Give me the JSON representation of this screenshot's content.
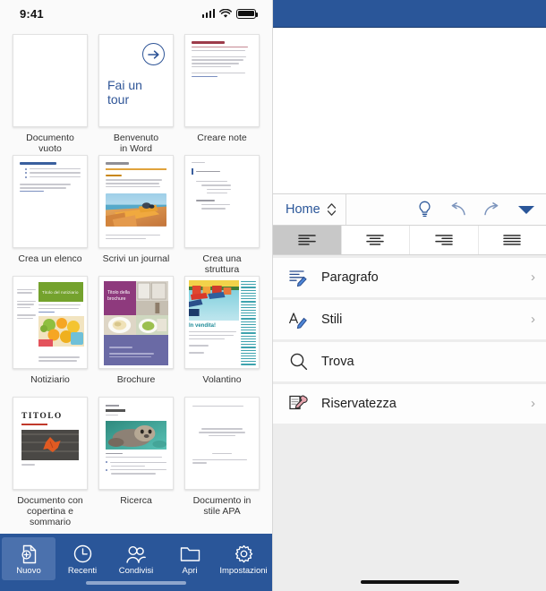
{
  "status_bar": {
    "time": "9:41",
    "signal_icon": "cellular-signal-icon",
    "wifi_icon": "wifi-icon",
    "battery_icon": "battery-full-icon"
  },
  "colors": {
    "brand_blue": "#2a5699",
    "tab_selected": "#4b71ad",
    "accent_green": "#74a22d",
    "accent_purple": "#8e3a7d",
    "accent_teal": "#1f8b98",
    "accent_orange": "#e0a33c",
    "accent_red": "#c0392b"
  },
  "templates": [
    {
      "label": "Documento\nvuoto",
      "name": "documento-vuoto",
      "kind": "blank"
    },
    {
      "label": "Benvenuto\nin Word",
      "name": "benvenuto-in-word",
      "kind": "tour",
      "tour_text": "Fai un\ntour"
    },
    {
      "label": "Creare note",
      "name": "creare-note",
      "kind": "notes"
    },
    {
      "label": "Crea un elenco",
      "name": "crea-un-elenco",
      "kind": "list"
    },
    {
      "label": "Scrivi un journal",
      "name": "scrivi-un-journal",
      "kind": "journal"
    },
    {
      "label": "Crea una\nstruttura",
      "name": "crea-una-struttura",
      "kind": "outline"
    },
    {
      "label": "Notiziario",
      "name": "notiziario",
      "kind": "newsletter",
      "heading": "Titolo del notiziario"
    },
    {
      "label": "Brochure",
      "name": "brochure",
      "kind": "brochure",
      "heading": "Titolo della\nbrochure"
    },
    {
      "label": "Volantino",
      "name": "volantino",
      "kind": "flyer",
      "heading": "In vendita!"
    },
    {
      "label": "Documento con\ncopertina e\nsommario",
      "name": "documento-con-copertina-e-sommario",
      "kind": "cover",
      "heading": "TITOLO"
    },
    {
      "label": "Ricerca",
      "name": "ricerca",
      "kind": "report"
    },
    {
      "label": "Documento in\nstile APA",
      "name": "documento-in-stile-apa",
      "kind": "apa"
    }
  ],
  "tabbar": {
    "items": [
      {
        "label": "Nuovo",
        "name": "tab-nuovo",
        "icon": "new-document-icon",
        "selected": true
      },
      {
        "label": "Recenti",
        "name": "tab-recenti",
        "icon": "clock-icon",
        "selected": false
      },
      {
        "label": "Condivisi",
        "name": "tab-condivisi",
        "icon": "people-icon",
        "selected": false
      },
      {
        "label": "Apri",
        "name": "tab-apri",
        "icon": "folder-icon",
        "selected": false
      },
      {
        "label": "Impostazioni",
        "name": "tab-impostazioni",
        "icon": "gear-icon",
        "selected": false
      }
    ]
  },
  "editor": {
    "ribbon": {
      "tab_name": "Home",
      "stepper_icon": "chevron-up-down-icon",
      "actions": [
        {
          "name": "tell-me-button",
          "icon": "lightbulb-icon"
        },
        {
          "name": "undo-button",
          "icon": "undo-arrow-icon"
        },
        {
          "name": "redo-button",
          "icon": "redo-arrow-icon"
        },
        {
          "name": "ribbon-collapse-button",
          "icon": "triangle-down-icon"
        }
      ]
    },
    "alignment": [
      {
        "name": "align-left-button",
        "icon": "align-left-icon",
        "selected": true
      },
      {
        "name": "align-center-button",
        "icon": "align-center-icon",
        "selected": false
      },
      {
        "name": "align-right-button",
        "icon": "align-right-icon",
        "selected": false
      },
      {
        "name": "align-justify-button",
        "icon": "align-justify-icon",
        "selected": false
      }
    ],
    "menu": [
      {
        "label": "Paragrafo",
        "name": "menu-item-paragrafo",
        "icon": "paragraph-format-icon",
        "chevron": "›",
        "has_chevron": true
      },
      {
        "label": "Stili",
        "name": "menu-item-stili",
        "icon": "styles-icon",
        "chevron": "›",
        "has_chevron": true
      },
      {
        "label": "Trova",
        "name": "menu-item-trova",
        "icon": "search-icon",
        "chevron": "",
        "has_chevron": false
      },
      {
        "label": "Riservatezza",
        "name": "menu-item-riservatezza",
        "icon": "privacy-stamp-icon",
        "chevron": "›",
        "has_chevron": true
      }
    ]
  }
}
